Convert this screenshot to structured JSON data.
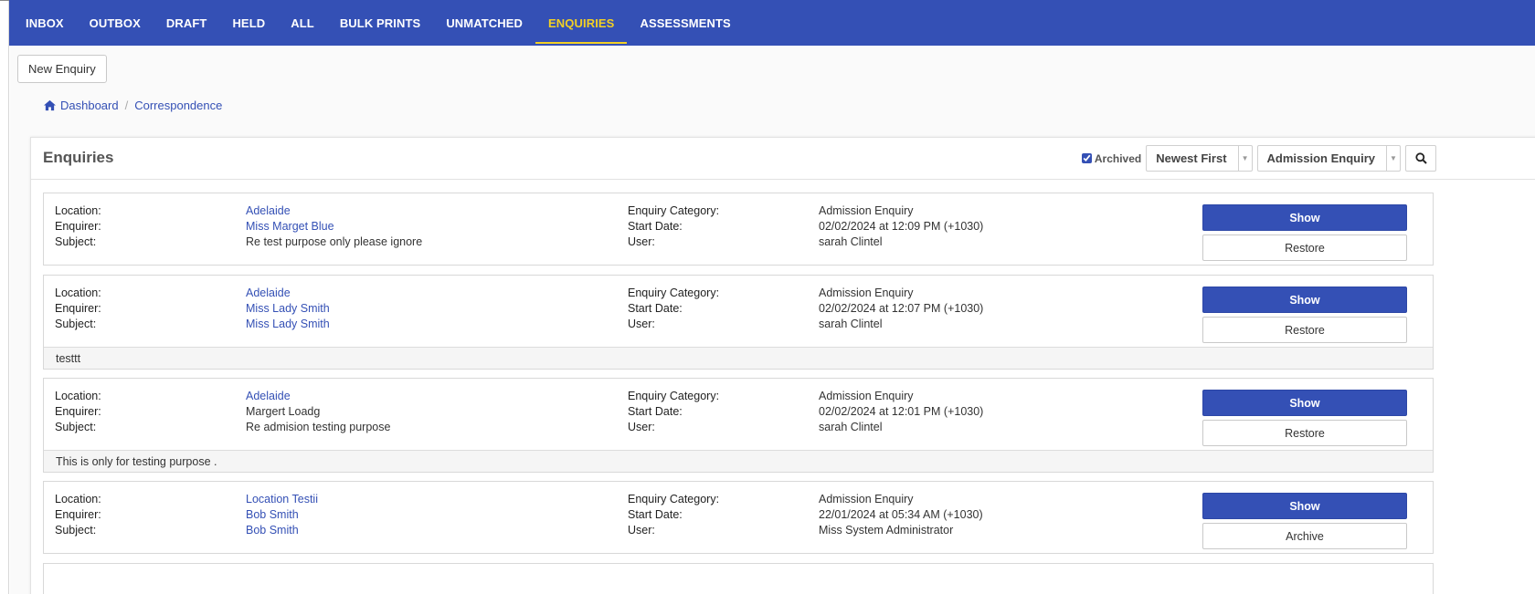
{
  "nav": {
    "items": [
      "INBOX",
      "OUTBOX",
      "DRAFT",
      "HELD",
      "ALL",
      "BULK PRINTS",
      "UNMATCHED",
      "ENQUIRIES",
      "ASSESSMENTS"
    ],
    "active_index": 7
  },
  "toolbar": {
    "new_label": "New Enquiry"
  },
  "breadcrumb": {
    "home": "Dashboard",
    "current": "Correspondence"
  },
  "panel": {
    "title": "Enquiries",
    "archived_label": "Archived",
    "archived_checked": true,
    "sort_value": "Newest First",
    "category_value": "Admission Enquiry"
  },
  "labels": {
    "location": "Location:",
    "enquirer": "Enquirer:",
    "subject": "Subject:",
    "category": "Enquiry Category:",
    "start_date": "Start Date:",
    "user": "User:",
    "show": "Show"
  },
  "enquiries": [
    {
      "location": "Adelaide",
      "enquirer": "Miss Marget Blue",
      "subject": "Re test purpose only please ignore",
      "category": "Admission Enquiry",
      "start_date": "02/02/2024 at 12:09 PM (+1030)",
      "user": "sarah Clintel",
      "action": "Restore",
      "note": ""
    },
    {
      "location": "Adelaide",
      "enquirer": "Miss Lady Smith",
      "subject": "Miss Lady Smith",
      "category": "Admission Enquiry",
      "start_date": "02/02/2024 at 12:07 PM (+1030)",
      "user": "sarah Clintel",
      "action": "Restore",
      "note": "testtt"
    },
    {
      "location": "Adelaide",
      "enquirer": "Margert Loadg",
      "subject": "Re admision testing purpose",
      "category": "Admission Enquiry",
      "start_date": "02/02/2024 at 12:01 PM (+1030)",
      "user": "sarah Clintel",
      "action": "Restore",
      "note": "This is only for testing purpose ."
    },
    {
      "location": "Location Testii",
      "enquirer": "Bob Smith",
      "subject": "Bob Smith",
      "category": "Admission Enquiry",
      "start_date": "22/01/2024 at 05:34 AM (+1030)",
      "user": "Miss System Administrator",
      "action": "Archive",
      "note": ""
    }
  ],
  "colors": {
    "primary": "#3450b5",
    "active_tab": "#f2d024"
  }
}
